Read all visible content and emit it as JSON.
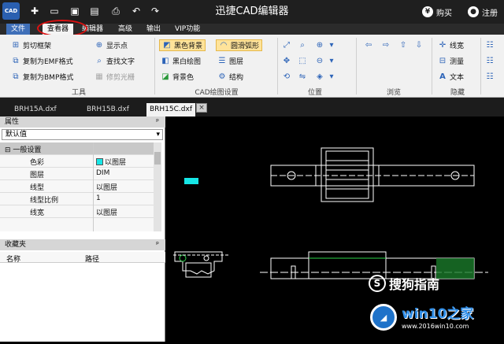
{
  "title_bar": {
    "app_icon_text": "CAD",
    "title": "迅捷CAD编辑器",
    "buy": "购买",
    "register": "注册"
  },
  "menu": [
    "文件",
    "查看器",
    "编辑器",
    "高级",
    "输出",
    "VIP功能"
  ],
  "ribbon": {
    "tools": {
      "label": "工具",
      "items": [
        "剪切框架",
        "复制为EMF格式",
        "复制为BMP格式",
        "显示点",
        "查找文字",
        "修剪光栅"
      ]
    },
    "cad_settings": {
      "label": "CAD绘图设置",
      "items": [
        "黑色背景",
        "黑白绘图",
        "背景色",
        "圆滑弧形",
        "图层",
        "结构"
      ]
    },
    "position": {
      "label": "位置"
    },
    "browse": {
      "label": "浏览"
    },
    "hide": {
      "label": "隐藏",
      "items": [
        "线宽",
        "测量",
        "文本"
      ]
    }
  },
  "tabs": [
    "BRH15A.dxf",
    "BRH15B.dxf",
    "BRH15C.dxf"
  ],
  "tab_close": "×",
  "properties": {
    "header": "属性",
    "pin": "ᵖ",
    "filter": "默认值",
    "category": "一般设置",
    "rows": [
      {
        "key": "色彩",
        "value": "以图层"
      },
      {
        "key": "图层",
        "value": "DIM"
      },
      {
        "key": "线型",
        "value": "以图层"
      },
      {
        "key": "线型比例",
        "value": "1"
      },
      {
        "key": "线宽",
        "value": "以图层"
      }
    ]
  },
  "favorites": {
    "header": "收藏夹",
    "col_name": "名称",
    "col_path": "路径"
  },
  "watermarks": {
    "sogou": "搜狗指南",
    "win10": "win10之家",
    "url": "www.2016win10.com"
  }
}
